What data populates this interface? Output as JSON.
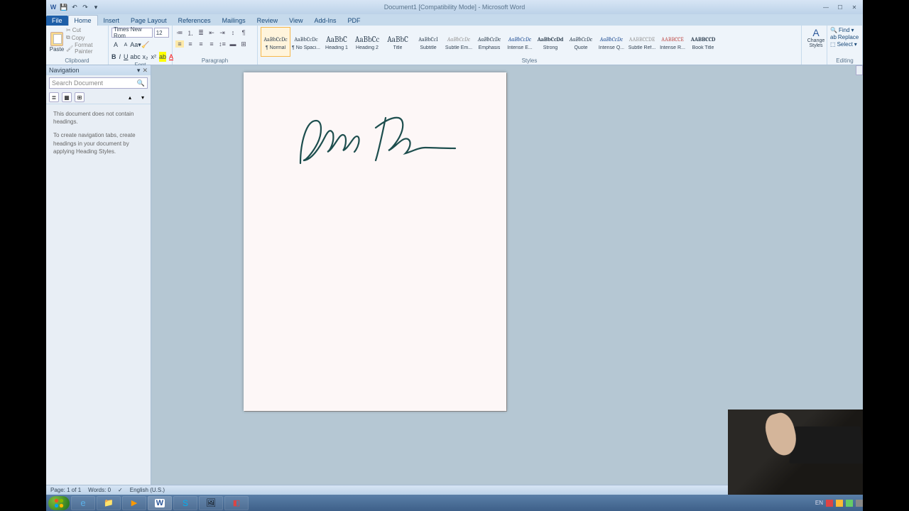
{
  "titlebar": {
    "title": "Document1 [Compatibility Mode] - Microsoft Word"
  },
  "tabs": {
    "file": "File",
    "home": "Home",
    "insert": "Insert",
    "pagelayout": "Page Layout",
    "references": "References",
    "mailings": "Mailings",
    "review": "Review",
    "view": "View",
    "addins": "Add-Ins",
    "pdf": "PDF"
  },
  "clipboard": {
    "paste": "Paste",
    "cut": "Cut",
    "copy": "Copy",
    "fmt": "Format Painter",
    "label": "Clipboard"
  },
  "font": {
    "name": "Times New Rom",
    "size": "12",
    "label": "Font"
  },
  "paragraph": {
    "label": "Paragraph"
  },
  "styles": {
    "label": "Styles",
    "change": "Change Styles",
    "items": [
      {
        "prev": "AaBbCcDc",
        "name": "¶ Normal",
        "sel": true
      },
      {
        "prev": "AaBbCcDc",
        "name": "¶ No Spaci..."
      },
      {
        "prev": "AaBbC",
        "name": "Heading 1",
        "big": true
      },
      {
        "prev": "AaBbCc",
        "name": "Heading 2",
        "big": true
      },
      {
        "prev": "AaBbC",
        "name": "Title",
        "big": true
      },
      {
        "prev": "AaBbCcI",
        "name": "Subtitle"
      },
      {
        "prev": "AaBbCcDc",
        "name": "Subtle Em...",
        "ital": true,
        "grey": true
      },
      {
        "prev": "AaBbCcDc",
        "name": "Emphasis",
        "ital": true
      },
      {
        "prev": "AaBbCcDc",
        "name": "Intense E...",
        "ital": true,
        "blue": true
      },
      {
        "prev": "AaBbCcDd",
        "name": "Strong",
        "bold": true
      },
      {
        "prev": "AaBbCcDc",
        "name": "Quote",
        "ital": true
      },
      {
        "prev": "AaBbCcDc",
        "name": "Intense Q...",
        "ital": true,
        "blue": true
      },
      {
        "prev": "AABBCCDE",
        "name": "Subtle Ref...",
        "grey": true
      },
      {
        "prev": "AABBCCE",
        "name": "Intense R...",
        "red": true
      },
      {
        "prev": "AABBCCD",
        "name": "Book Title",
        "bold": true
      }
    ]
  },
  "editing": {
    "find": "Find",
    "replace": "Replace",
    "select": "Select",
    "label": "Editing"
  },
  "nav": {
    "title": "Navigation",
    "search": "Search Document",
    "msg1": "This document does not contain headings.",
    "msg2": "To create navigation tabs, create headings in your document by applying Heading Styles."
  },
  "document": {
    "signature_text": "Jane Doe"
  },
  "status": {
    "page": "Page: 1 of 1",
    "words": "Words: 0",
    "lang": "English (U.S.)"
  },
  "tray_lang": "EN"
}
